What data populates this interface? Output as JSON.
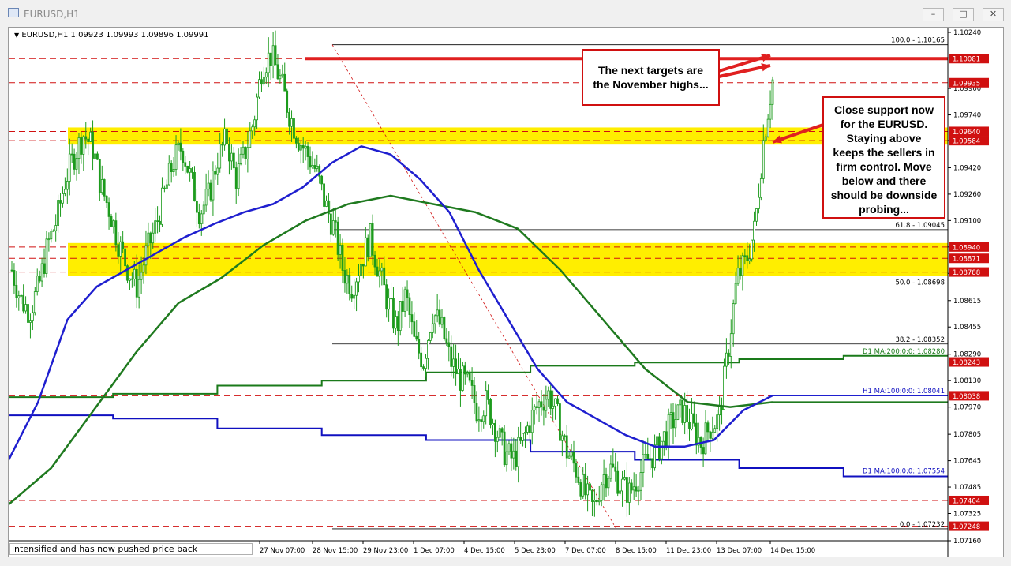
{
  "window": {
    "title": "EURUSD,H1",
    "buttons": [
      "minimize",
      "restore",
      "close"
    ]
  },
  "chart_header": "EURUSD,H1  1.09923 1.09993 1.09896 1.09991",
  "status_line": "intensified and has now pushed price back",
  "callouts": {
    "targets": [
      "The next targets are",
      "the November highs..."
    ],
    "support": [
      "Close support now",
      "for the EURUSD.",
      "Staying above",
      "keeps the sellers in",
      "firm control. Move",
      "below and there",
      "should be downside",
      "probing..."
    ]
  },
  "colors": {
    "candle": "#1d9b1d",
    "ma_blue": "#1f1fcf",
    "ma_green": "#1f7a1f",
    "support_zone": "#ffee00",
    "level_line": "#d01010",
    "fib_line": "#000000",
    "daily_ma100": "#1010c0",
    "daily_ma200": "#1a7a1a"
  },
  "chart_data": {
    "type": "line",
    "symbol": "EURUSD",
    "timeframe": "H1",
    "ylim": [
      1.0716,
      1.1024
    ],
    "price_ticks": [
      "1.10240",
      "1.10085",
      "1.09900",
      "1.09740",
      "1.09585",
      "1.09420",
      "1.09260",
      "1.09100",
      "1.08940",
      "1.08780",
      "1.08615",
      "1.08455",
      "1.08290",
      "1.08130",
      "1.07970",
      "1.07805",
      "1.07645",
      "1.07485",
      "1.07325",
      "1.07160"
    ],
    "time_labels": [
      {
        "label": "27 Nov 07:00",
        "x": 0
      },
      {
        "label": "28 Nov 15:00",
        "x": 1
      },
      {
        "label": "29 Nov 23:00",
        "x": 2
      },
      {
        "label": "1 Dec 07:00",
        "x": 3
      },
      {
        "label": "4 Dec 15:00",
        "x": 4
      },
      {
        "label": "5 Dec 23:00",
        "x": 5
      },
      {
        "label": "7 Dec 07:00",
        "x": 6
      },
      {
        "label": "8 Dec 15:00",
        "x": 7
      },
      {
        "label": "11 Dec 23:00",
        "x": 8
      },
      {
        "label": "13 Dec 07:00",
        "x": 9
      },
      {
        "label": "14 Dec 15:00",
        "x": 10
      }
    ],
    "zones": [
      {
        "name": "upper",
        "from": 1.09584,
        "to": 1.0964
      },
      {
        "name": "lower",
        "from": 1.08788,
        "to": 1.0894
      }
    ],
    "level_labels": [
      {
        "label": "1.10081",
        "value": 1.10081,
        "highlight": true
      },
      {
        "label": "1.09935",
        "value": 1.09935,
        "highlight": true
      },
      {
        "label": "1.09640",
        "value": 1.0964,
        "highlight": true
      },
      {
        "label": "1.09584",
        "value": 1.09584,
        "highlight": true
      },
      {
        "label": "1.08940",
        "value": 1.0894,
        "highlight": true
      },
      {
        "label": "1.08871",
        "value": 1.08871,
        "highlight": true
      },
      {
        "label": "1.08788",
        "value": 1.08788,
        "highlight": true
      },
      {
        "label": "1.08243",
        "value": 1.08243,
        "highlight": true
      },
      {
        "label": "1.08038",
        "value": 1.08038,
        "highlight": true
      },
      {
        "label": "1.07404",
        "value": 1.07404,
        "highlight": true
      },
      {
        "label": "1.07248",
        "value": 1.07248,
        "highlight": true
      }
    ],
    "fib_levels": [
      {
        "label": "100.0 - 1.10165",
        "value": 1.10165
      },
      {
        "label": "61.8 - 1.09045",
        "value": 1.09045
      },
      {
        "label": "50.0 - 1.08698",
        "value": 1.08698
      },
      {
        "label": "38.2 - 1.08352",
        "value": 1.08352
      },
      {
        "label": "0.0 - 1.07232",
        "value": 1.07232
      }
    ],
    "ma_labels": [
      {
        "label": "D1 MA:200:0:0: 1.08280",
        "value": 1.0828,
        "series": "daily_ma200"
      },
      {
        "label": "H1 MA:100:0:0: 1.08041",
        "value": 1.08041,
        "series": "ma_blue"
      },
      {
        "label": "D1 MA:100:0:0: 1.07554",
        "value": 1.07554,
        "series": "daily_ma100"
      }
    ],
    "price_path": [
      1.088,
      1.0862,
      1.0855,
      1.087,
      1.0895,
      1.091,
      1.0935,
      1.095,
      1.0962,
      1.0955,
      1.093,
      1.0915,
      1.0895,
      1.088,
      1.087,
      1.089,
      1.0905,
      1.0925,
      1.0945,
      1.0955,
      1.0935,
      1.0915,
      1.0925,
      1.0948,
      1.096,
      1.0935,
      1.095,
      1.097,
      1.1005,
      1.101,
      1.0995,
      1.0975,
      1.096,
      1.095,
      1.094,
      1.092,
      1.0905,
      1.088,
      1.087,
      1.0885,
      1.09,
      1.088,
      1.086,
      1.0845,
      1.0865,
      1.0835,
      1.0825,
      1.0855,
      1.0845,
      1.0825,
      1.0815,
      1.081,
      1.0795,
      1.08,
      1.0785,
      1.077,
      1.0765,
      1.0775,
      1.079,
      1.08,
      1.0805,
      1.079,
      1.077,
      1.076,
      1.0745,
      1.0735,
      1.0755,
      1.076,
      1.075,
      1.0745,
      1.0755,
      1.0765,
      1.077,
      1.078,
      1.079,
      1.0795,
      1.0785,
      1.0775,
      1.0785,
      1.079,
      1.083,
      1.0875,
      1.0885,
      1.0905,
      1.096,
      1.0995
    ],
    "ma_blue_path": [
      1.0765,
      1.08,
      1.085,
      1.087,
      1.088,
      1.089,
      1.09,
      1.0908,
      1.0915,
      1.092,
      1.093,
      1.0945,
      1.0955,
      1.095,
      1.0935,
      1.0915,
      1.088,
      1.085,
      1.082,
      1.08,
      1.079,
      1.078,
      1.0773,
      1.0773,
      1.0777,
      1.0795,
      1.0804
    ],
    "ma_green_path": [
      1.0738,
      1.076,
      1.0795,
      1.083,
      1.086,
      1.0875,
      1.0895,
      1.091,
      1.092,
      1.0925,
      1.092,
      1.0915,
      1.0905,
      1.088,
      1.085,
      1.082,
      1.08,
      1.0797,
      1.08
    ],
    "daily_ma200_path": [
      1.0803,
      1.0805,
      1.081,
      1.0813,
      1.0818,
      1.0822,
      1.0824,
      1.0826,
      1.0828
    ],
    "daily_ma100_path": [
      1.0792,
      1.079,
      1.0784,
      1.078,
      1.0777,
      1.077,
      1.0765,
      1.076,
      1.0755
    ]
  }
}
